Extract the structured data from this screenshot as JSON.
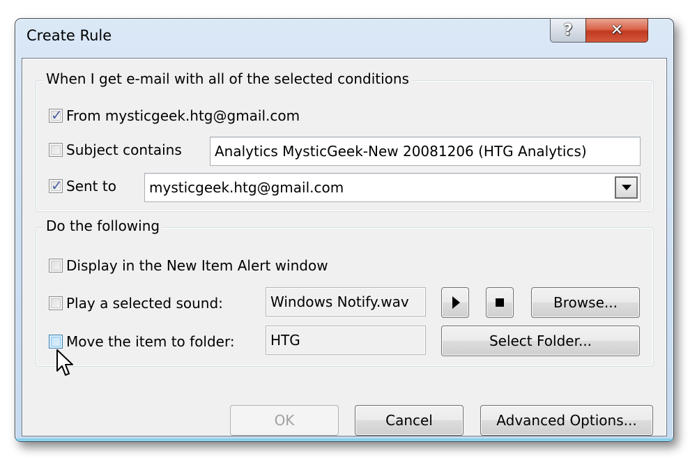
{
  "window": {
    "title": "Create Rule",
    "help_glyph": "?",
    "close_glyph": "✕"
  },
  "conditions": {
    "group_label": "When I get e-mail with all of the selected conditions",
    "from": {
      "label": "From mysticgeek.htg@gmail.com",
      "checked": true
    },
    "subject": {
      "label": "Subject contains",
      "checked": false,
      "value": "Analytics MysticGeek-New 20081206 (HTG Analytics)"
    },
    "sent_to": {
      "label": "Sent to",
      "checked": true,
      "value": "mysticgeek.htg@gmail.com"
    }
  },
  "actions": {
    "group_label": "Do the following",
    "display_alert": {
      "label": "Display in the New Item Alert window",
      "checked": false
    },
    "play_sound": {
      "label": "Play a selected sound:",
      "checked": false,
      "value": "Windows Notify.wav",
      "browse_label": "Browse..."
    },
    "move_folder": {
      "label": "Move the item to folder:",
      "checked": false,
      "value": "HTG",
      "select_label": "Select Folder..."
    }
  },
  "footer": {
    "ok_label": "OK",
    "cancel_label": "Cancel",
    "advanced_label": "Advanced Options..."
  }
}
